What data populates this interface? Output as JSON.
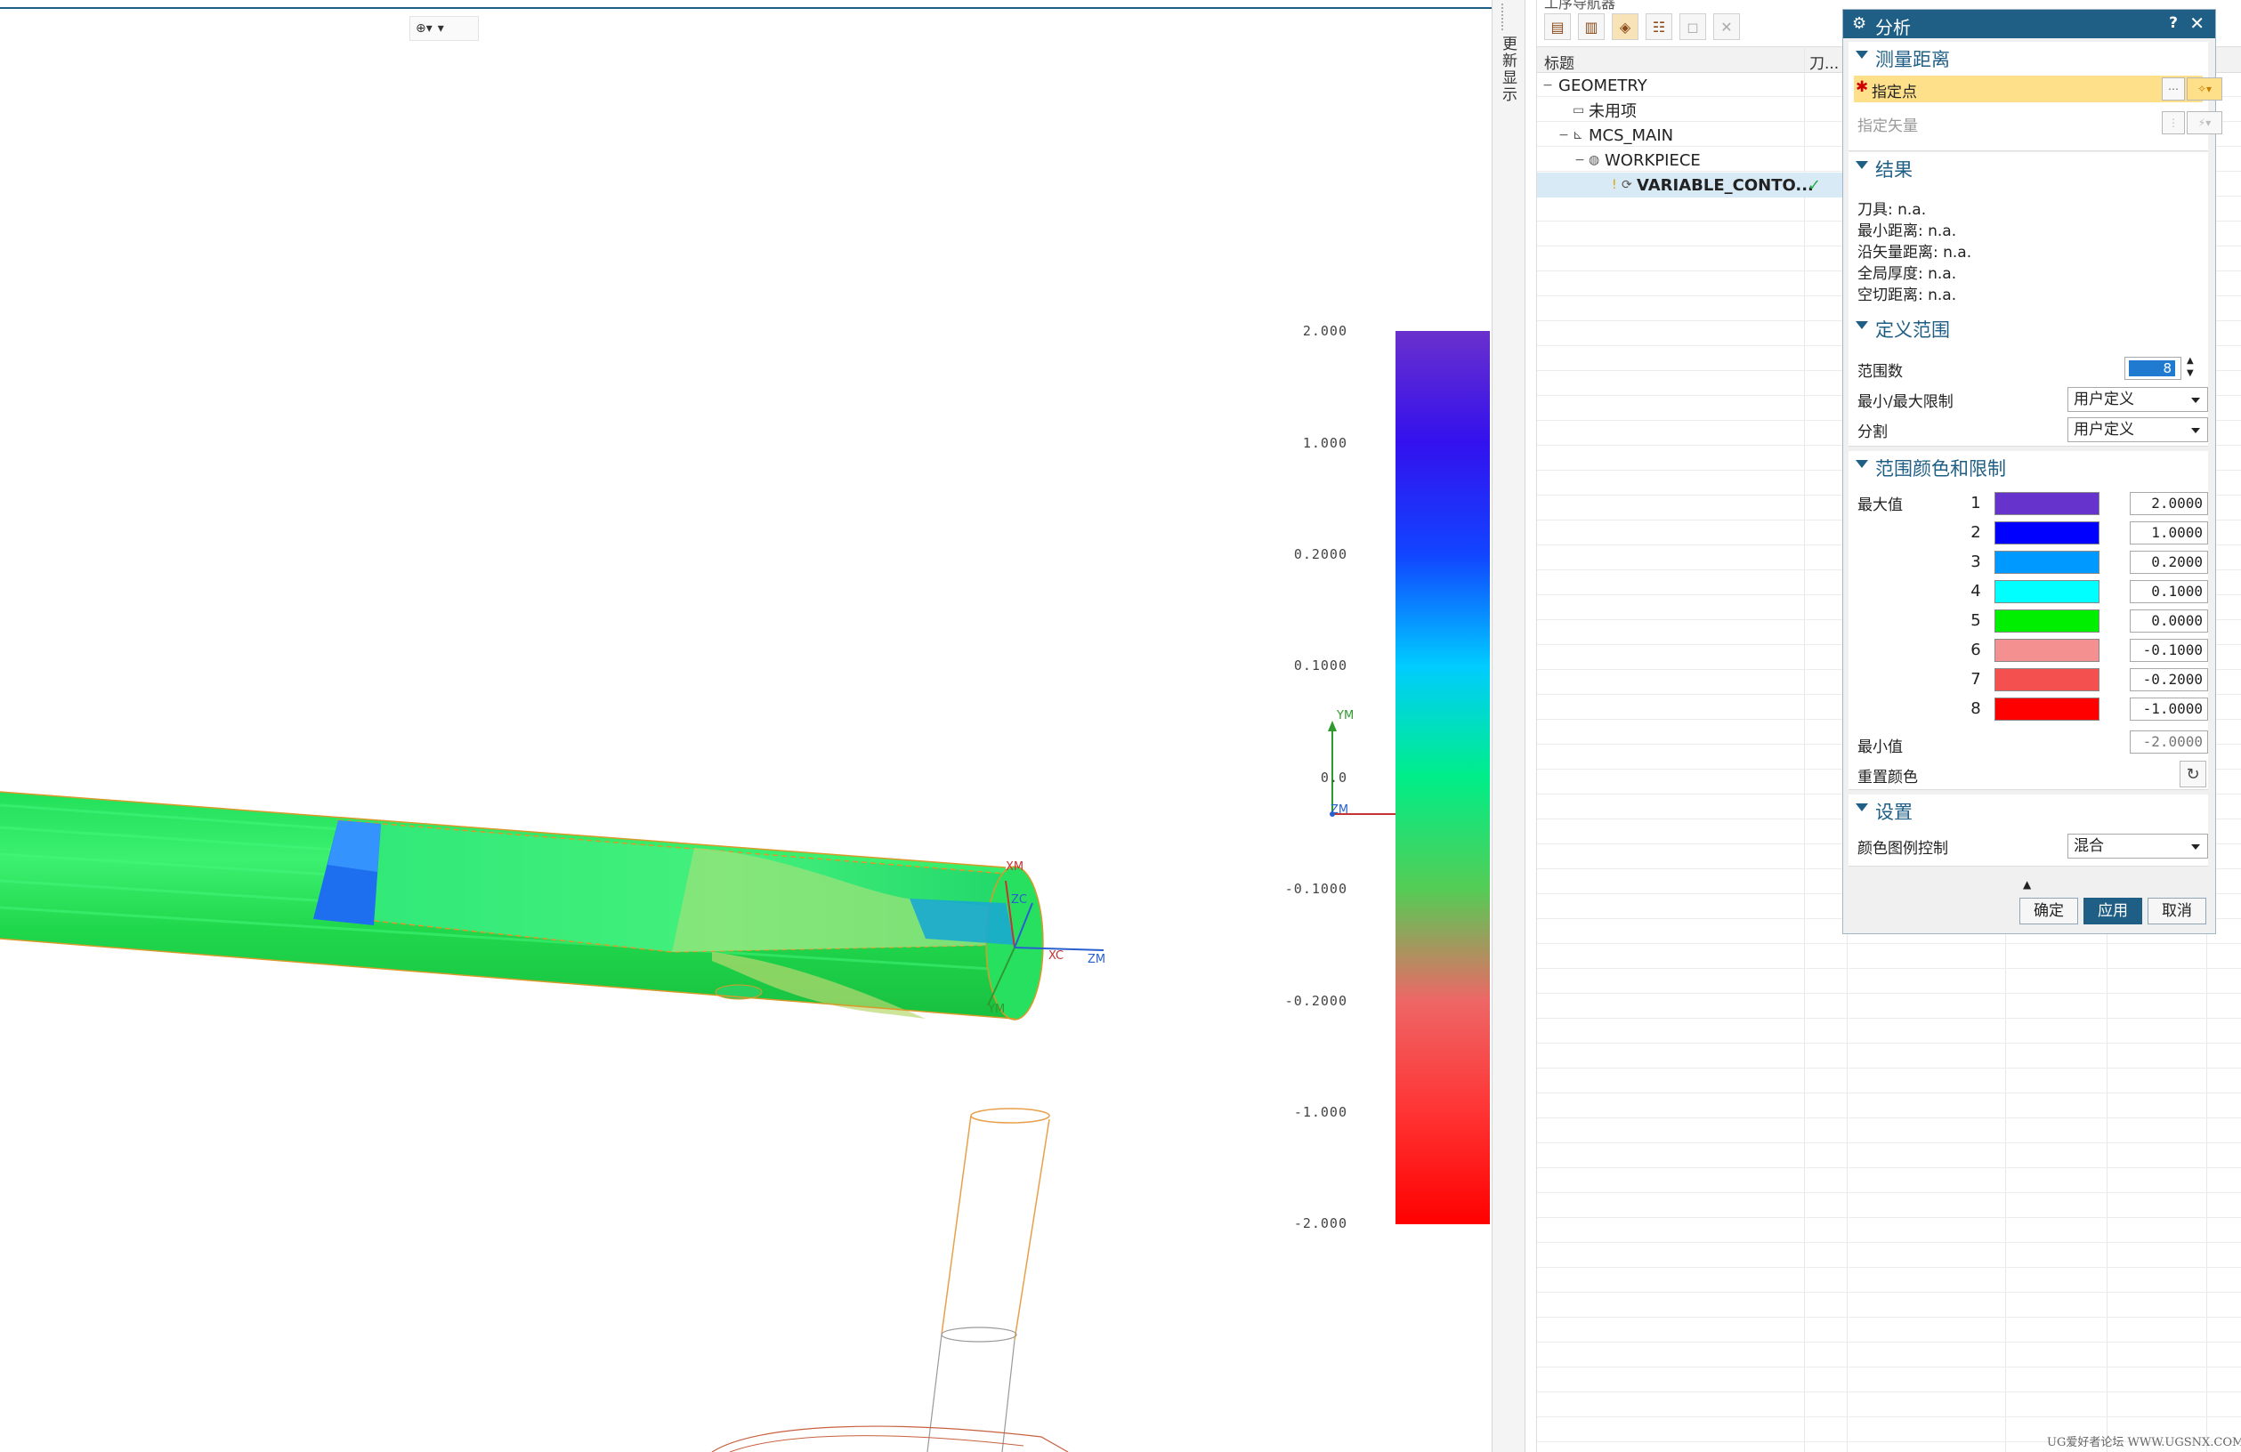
{
  "viewport": {
    "snap_tool_icon": "crosshair-icon",
    "triad_labels": {
      "ym": "YM",
      "zm": "ZM",
      "xm": "XM"
    },
    "part_axes": {
      "xm": "XM",
      "zc": "ZC",
      "xc": "XC",
      "zm": "ZM",
      "ym": "YM"
    },
    "legend_ticks": [
      "2.000",
      "1.000",
      "0.2000",
      "0.1000",
      "0.0",
      "-0.1000",
      "-0.2000",
      "-1.000",
      "-2.000"
    ]
  },
  "side_strip": {
    "tab_label": "更新显示"
  },
  "navigator": {
    "header_partial": "工序导航器",
    "columns": [
      "标题",
      "刀..."
    ],
    "rows": [
      {
        "label": "GEOMETRY",
        "level": 0,
        "expander": "−"
      },
      {
        "label": "未用项",
        "level": 1,
        "expander": ""
      },
      {
        "label": "MCS_MAIN",
        "level": 1,
        "expander": "−"
      },
      {
        "label": "WORKPIECE",
        "level": 2,
        "expander": "−"
      },
      {
        "label": "VARIABLE_CONTO...",
        "level": 3,
        "expander": "",
        "status": "✓"
      }
    ]
  },
  "dialog": {
    "title": "分析",
    "help": "?",
    "close": "✕",
    "measure": {
      "header": "测量距离",
      "specify_point": "指定点",
      "specify_vector": "指定矢量"
    },
    "results": {
      "header": "结果",
      "lines": [
        "刀具: n.a.",
        "最小距离: n.a.",
        "沿矢量距离: n.a.",
        "全局厚度: n.a.",
        "空切距离: n.a."
      ]
    },
    "range": {
      "header": "定义范围",
      "count_label": "范围数",
      "count_value": "8",
      "minmax_label": "最小/最大限制",
      "minmax_value": "用户定义",
      "split_label": "分割",
      "split_value": "用户定义"
    },
    "colors": {
      "header": "范围颜色和限制",
      "max_label": "最大值",
      "min_label": "最小值",
      "min_value": "-2.0000",
      "reset_label": "重置颜色",
      "rows": [
        {
          "n": "1",
          "color": "#6633cc",
          "value": "2.0000"
        },
        {
          "n": "2",
          "color": "#0000ff",
          "value": "1.0000"
        },
        {
          "n": "3",
          "color": "#0099ff",
          "value": "0.2000"
        },
        {
          "n": "4",
          "color": "#00ffff",
          "value": "0.1000"
        },
        {
          "n": "5",
          "color": "#00ee00",
          "value": "0.0000"
        },
        {
          "n": "6",
          "color": "#f49090",
          "value": "-0.1000"
        },
        {
          "n": "7",
          "color": "#f45050",
          "value": "-0.2000"
        },
        {
          "n": "8",
          "color": "#ff0000",
          "value": "-1.0000"
        }
      ]
    },
    "settings": {
      "header": "设置",
      "legend_label": "颜色图例控制",
      "legend_value": "混合"
    },
    "buttons": {
      "ok": "确定",
      "apply": "应用",
      "cancel": "取消"
    }
  },
  "watermark": "UG爱好者论坛 WWW.UGSNX.COM"
}
